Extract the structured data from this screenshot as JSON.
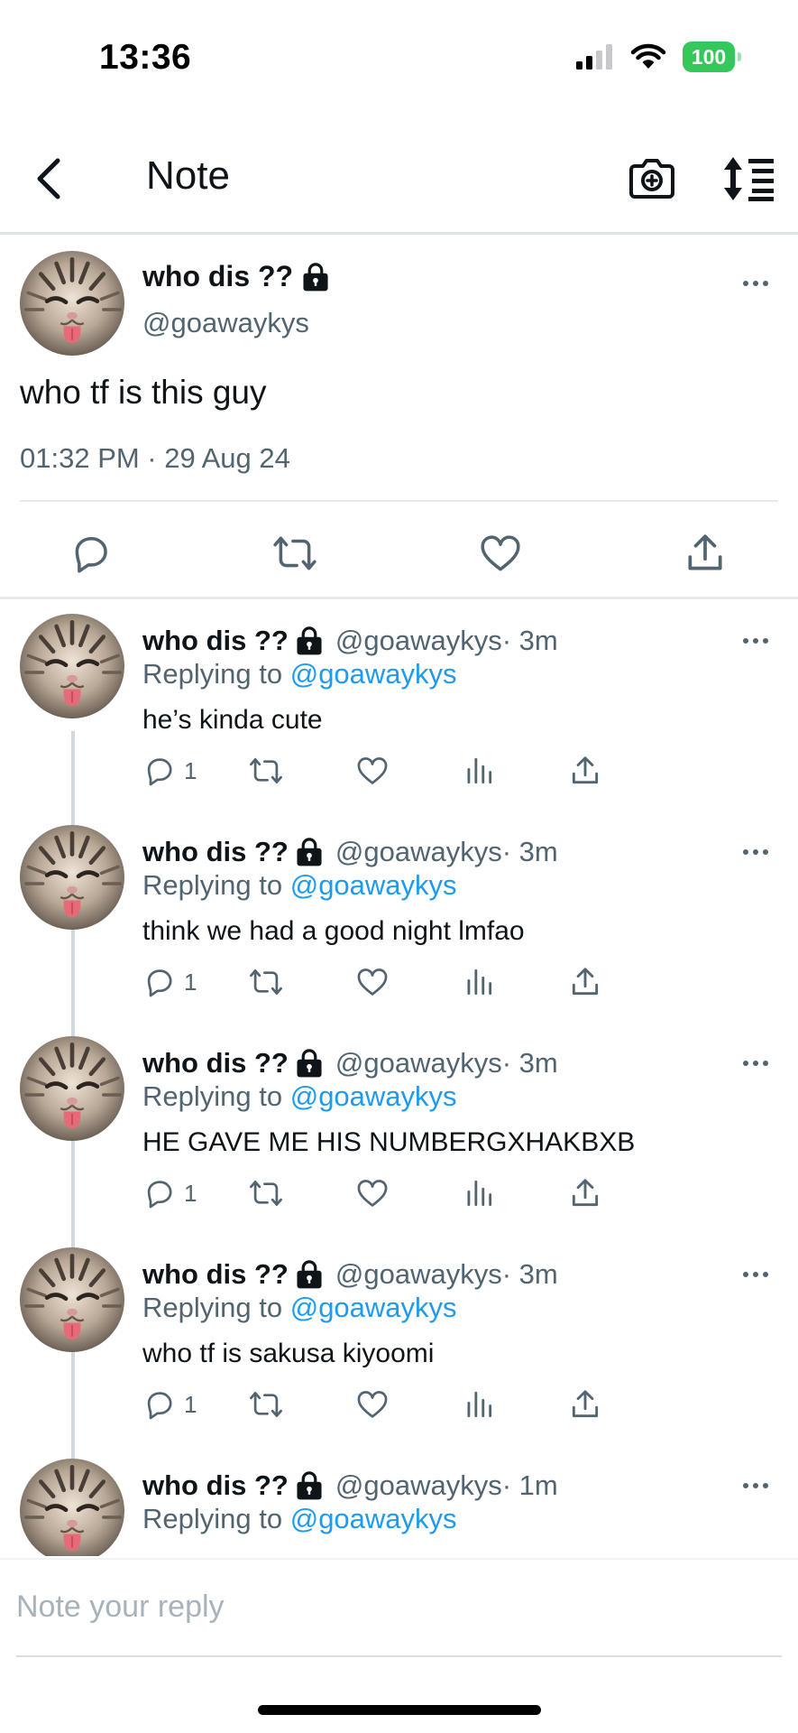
{
  "status": {
    "time": "13:36",
    "battery": "100"
  },
  "nav": {
    "title": "Note"
  },
  "note": {
    "name": "who dis ??",
    "handle": "@goawaykys",
    "text": "who tf is this guy",
    "timestamp": "01:32 PM · 29 Aug 24"
  },
  "replies": [
    {
      "name": "who dis ??",
      "handle": "@goawaykys",
      "time": " · 3m",
      "replying_prefix": "Replying to ",
      "replying_to": "@goawaykys",
      "text": "he’s kinda cute",
      "reply_count": "1"
    },
    {
      "name": "who dis ??",
      "handle": "@goawaykys",
      "time": " · 3m",
      "replying_prefix": "Replying to ",
      "replying_to": "@goawaykys",
      "text": "think we had a good night lmfao",
      "reply_count": "1"
    },
    {
      "name": "who dis ??",
      "handle": "@goawaykys",
      "time": " · 3m",
      "replying_prefix": "Replying to ",
      "replying_to": "@goawaykys",
      "text": "HE GAVE ME HIS NUMBERGXHAKBXB",
      "reply_count": "1"
    },
    {
      "name": "who dis ??",
      "handle": "@goawaykys",
      "time": " · 3m",
      "replying_prefix": "Replying to ",
      "replying_to": "@goawaykys",
      "text": "who tf is sakusa kiyoomi",
      "reply_count": "1"
    },
    {
      "name": "who dis ??",
      "handle": "@goawaykys",
      "time": " · 1m",
      "replying_prefix": "Replying to ",
      "replying_to": "@goawaykys",
      "text": "",
      "reply_count": ""
    }
  ],
  "composer": {
    "placeholder": "Note your reply"
  },
  "colors": {
    "accent": "#1d9bf0",
    "muted": "#536471",
    "battery": "#34c759"
  },
  "icons": [
    "back-arrow-icon",
    "camera-icon",
    "sort-icon",
    "lock-icon",
    "more-icon",
    "comment-icon",
    "retweet-icon",
    "heart-icon",
    "stats-icon",
    "share-icon"
  ]
}
